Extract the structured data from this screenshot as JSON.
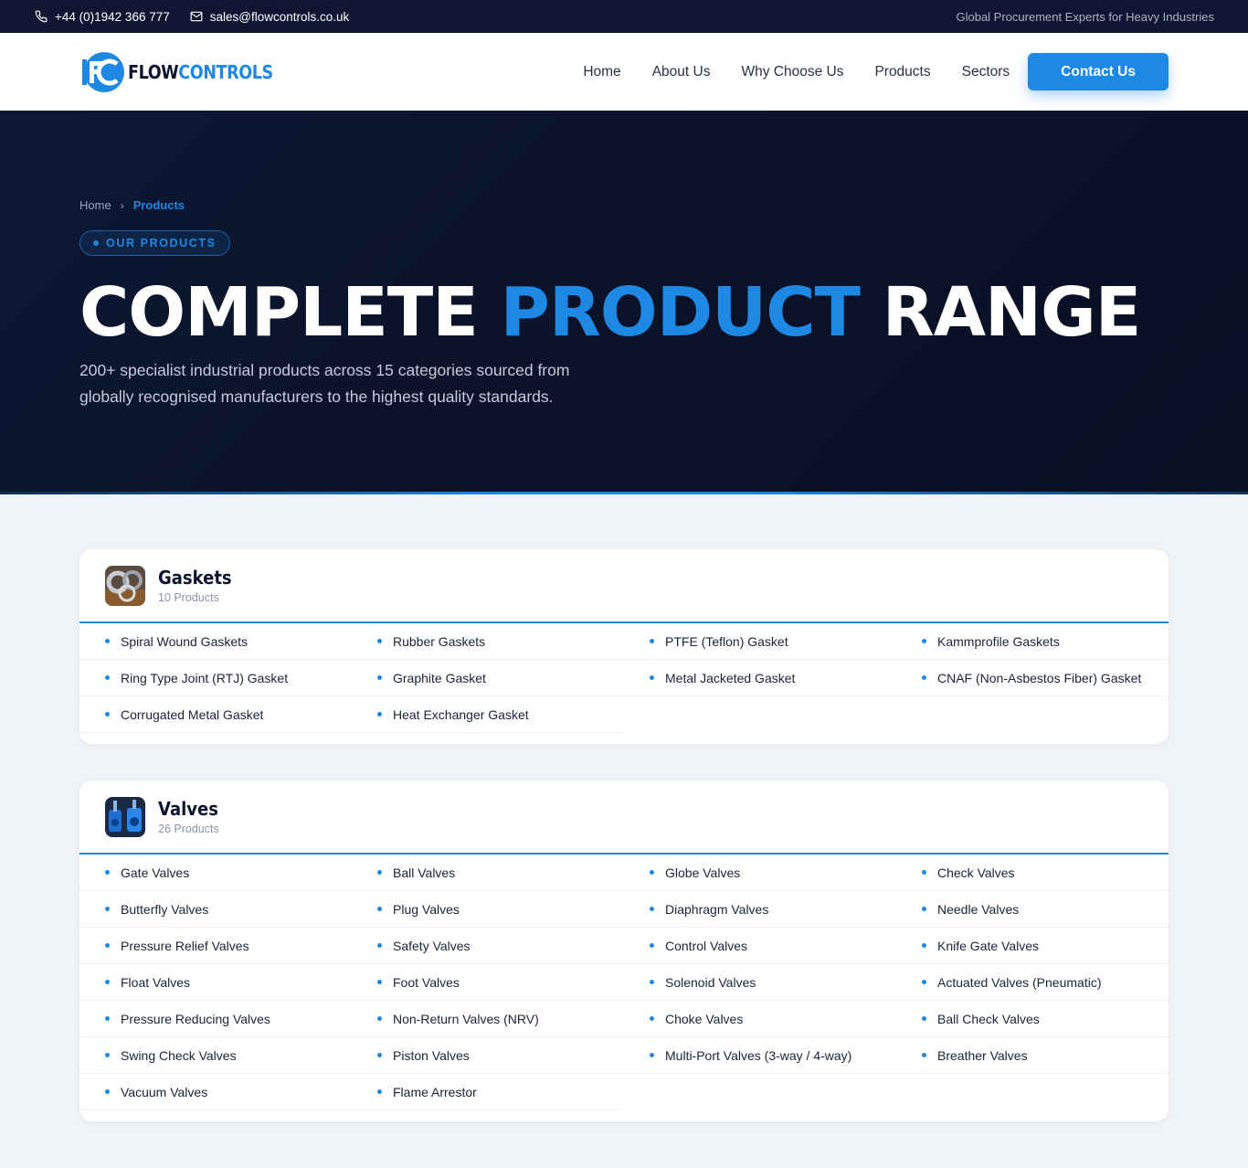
{
  "topbar": {
    "phone": "+44 (0)1942 366 777",
    "email": "sales@flowcontrols.co.uk",
    "tagline": "Global Procurement Experts for Heavy Industries"
  },
  "header": {
    "logo_part1": "FLOW",
    "logo_part2": "CONTROLS",
    "nav": [
      "Home",
      "About Us",
      "Why Choose Us",
      "Products",
      "Sectors"
    ],
    "cta": "Contact Us"
  },
  "hero": {
    "breadcrumb_home": "Home",
    "breadcrumb_current": "Products",
    "badge": "OUR PRODUCTS",
    "title_part1": "COMPLETE ",
    "title_highlight": "PRODUCT",
    "title_part2": " RANGE",
    "description": "200+ specialist industrial products across 15 categories sourced from globally recognised manufacturers to the highest quality standards."
  },
  "categories": [
    {
      "name": "Gaskets",
      "count": "10 Products",
      "products": [
        "Spiral Wound Gaskets",
        "Rubber Gaskets",
        "PTFE (Teflon) Gasket",
        "Kammprofile Gaskets",
        "Ring Type Joint (RTJ) Gasket",
        "Graphite Gasket",
        "Metal Jacketed Gasket",
        "CNAF (Non-Asbestos Fiber) Gasket",
        "Corrugated Metal Gasket",
        "Heat Exchanger Gasket"
      ]
    },
    {
      "name": "Valves",
      "count": "26 Products",
      "products": [
        "Gate Valves",
        "Ball Valves",
        "Globe Valves",
        "Check Valves",
        "Butterfly Valves",
        "Plug Valves",
        "Diaphragm Valves",
        "Needle Valves",
        "Pressure Relief Valves",
        "Safety Valves",
        "Control Valves",
        "Knife Gate Valves",
        "Float Valves",
        "Foot Valves",
        "Solenoid Valves",
        "Actuated Valves (Pneumatic)",
        "Pressure Reducing Valves",
        "Non-Return Valves (NRV)",
        "Choke Valves",
        "Ball Check Valves",
        "Swing Check Valves",
        "Piston Valves",
        "Multi-Port Valves (3-way / 4-way)",
        "Breather Valves",
        "Vacuum Valves",
        "Flame Arrestor"
      ]
    }
  ],
  "colors": {
    "accent": "#1e88e5",
    "dark": "#0b1530",
    "topbar": "#0e1631"
  }
}
